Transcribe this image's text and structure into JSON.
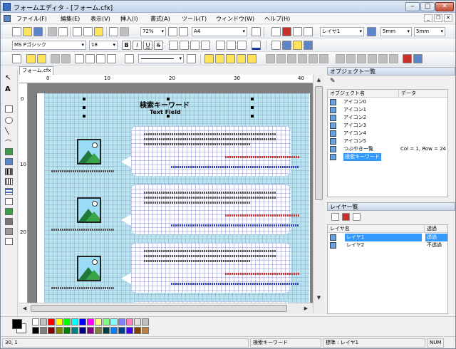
{
  "window": {
    "title": "フォームエディタ - [フォーム.cfx]",
    "minimize": "‒",
    "maximize": "□",
    "close": "✕"
  },
  "menu": [
    "ファイル(F)",
    "編集(E)",
    "表示(V)",
    "挿入(I)",
    "書式(A)",
    "ツール(T)",
    "ウィンドウ(W)",
    "ヘルプ(H)"
  ],
  "toolbar": {
    "zoom": "72%",
    "paper": "A4",
    "layer": "レイヤ1",
    "grid_x": "5mm",
    "grid_y": "5mm",
    "font_name": "MS Pゴシック",
    "font_size": "18",
    "bold": "B",
    "italic": "I",
    "underline": "U",
    "strike": "S"
  },
  "document_tab": "フォーム.cfx",
  "ruler": {
    "h": [
      "0",
      "10",
      "20",
      "30",
      "40"
    ],
    "v": [
      "0",
      "10",
      "20"
    ]
  },
  "canvas": {
    "title_text": "検索キーワード",
    "subtitle_text": "Text Field"
  },
  "objects_panel": {
    "title": "オブジェクト一覧",
    "col_name": "オブジェクト名",
    "col_data": "データ",
    "rows": [
      {
        "name": "アイコン0",
        "data": ""
      },
      {
        "name": "アイコン1",
        "data": ""
      },
      {
        "name": "アイコン2",
        "data": ""
      },
      {
        "name": "アイコン3",
        "data": ""
      },
      {
        "name": "アイコン4",
        "data": ""
      },
      {
        "name": "アイコン5",
        "data": ""
      },
      {
        "name": "つぶやき一覧",
        "data": "Col = 1, Row = 24"
      },
      {
        "name": "検索キーワード",
        "data": ""
      }
    ],
    "selected_index": 7
  },
  "layer_panel": {
    "title": "レイヤ一覧",
    "col_name": "レイヤ名",
    "col_state": "透過",
    "rows": [
      {
        "name": "レイヤ1",
        "state": "透過"
      },
      {
        "name": "レイヤ2",
        "state": "不透過"
      }
    ],
    "selected_index": 0
  },
  "palette": {
    "row1": [
      "#ffffff",
      "#c0c0c0",
      "#ff0000",
      "#ffff00",
      "#00ff00",
      "#00ffff",
      "#0000ff",
      "#ff00ff",
      "#ffff80",
      "#80ff80",
      "#80ffff",
      "#8080ff",
      "#ff80c0",
      "#e0e0e0",
      "#c0c0c0"
    ],
    "row2": [
      "#000000",
      "#808080",
      "#800000",
      "#808000",
      "#008000",
      "#008080",
      "#000080",
      "#800080",
      "#808040",
      "#004040",
      "#0080ff",
      "#004080",
      "#4000ff",
      "#804000",
      "#c08040"
    ]
  },
  "status": {
    "coords": "30, 1",
    "object": "検索キーワード",
    "layer": "標準 : レイヤ1",
    "num": "NUM"
  }
}
